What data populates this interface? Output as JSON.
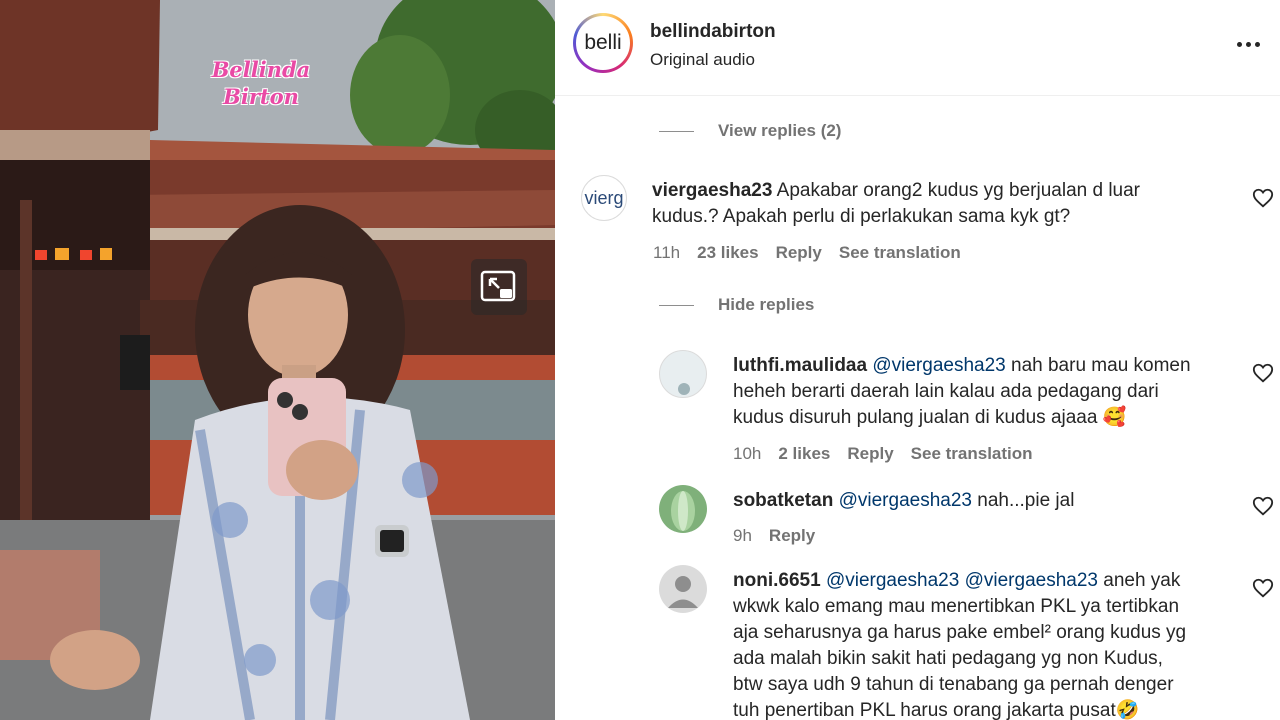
{
  "video": {
    "watermark_line1": "Bellinda",
    "watermark_line2": "Birton"
  },
  "header": {
    "avatar_text": "belli",
    "username": "bellindabirton",
    "subtitle": "Original audio"
  },
  "toggles": {
    "view_replies": "View replies (2)",
    "hide_replies": "Hide replies"
  },
  "comments": [
    {
      "avatar_text": "vierg",
      "username": "viergaesha23",
      "line1": " Apakabar orang2 kudus yg berjualan d luar",
      "line2": "kudus.? Apakah perlu di perlakukan sama kyk gt?",
      "time": "11h",
      "likes": "23 likes",
      "reply": "Reply",
      "translate": "See translation"
    }
  ],
  "replies": [
    {
      "username": "luthfi.maulidaa",
      "mention": "@viergaesha23",
      "line1_rest": " nah baru mau komen",
      "line2": "heheh berarti daerah lain kalau ada pedagang dari",
      "line3": "kudus disuruh pulang jualan di kudus ajaaa 🥰",
      "time": "10h",
      "likes": "2 likes",
      "reply": "Reply",
      "translate": "See translation"
    },
    {
      "username": "sobatketan",
      "mention": "@viergaesha23",
      "line1_rest": " nah...pie jal",
      "time": "9h",
      "reply": "Reply"
    },
    {
      "username": "noni.6651",
      "mention": "@viergaesha23",
      "mention2": "@viergaesha23",
      "line1_rest": " aneh yak",
      "line2": "wkwk kalo emang mau menertibkan PKL ya tertibkan",
      "line3": "aja seharusnya ga harus pake embel² orang kudus yg",
      "line4": "ada malah bikin sakit hati pedagang yg non Kudus,",
      "line5": "btw saya udh 9 tahun di tenabang ga pernah denger",
      "line6": "tuh penertiban PKL harus orang jakarta pusat🤣"
    }
  ],
  "icons": {
    "pip": "picture-in-picture-icon",
    "more": "more-horizontal-icon",
    "heart": "heart-outline-icon"
  },
  "colors": {
    "watermark": "#e94aa5",
    "mention": "#00376b",
    "muted": "#737373"
  }
}
